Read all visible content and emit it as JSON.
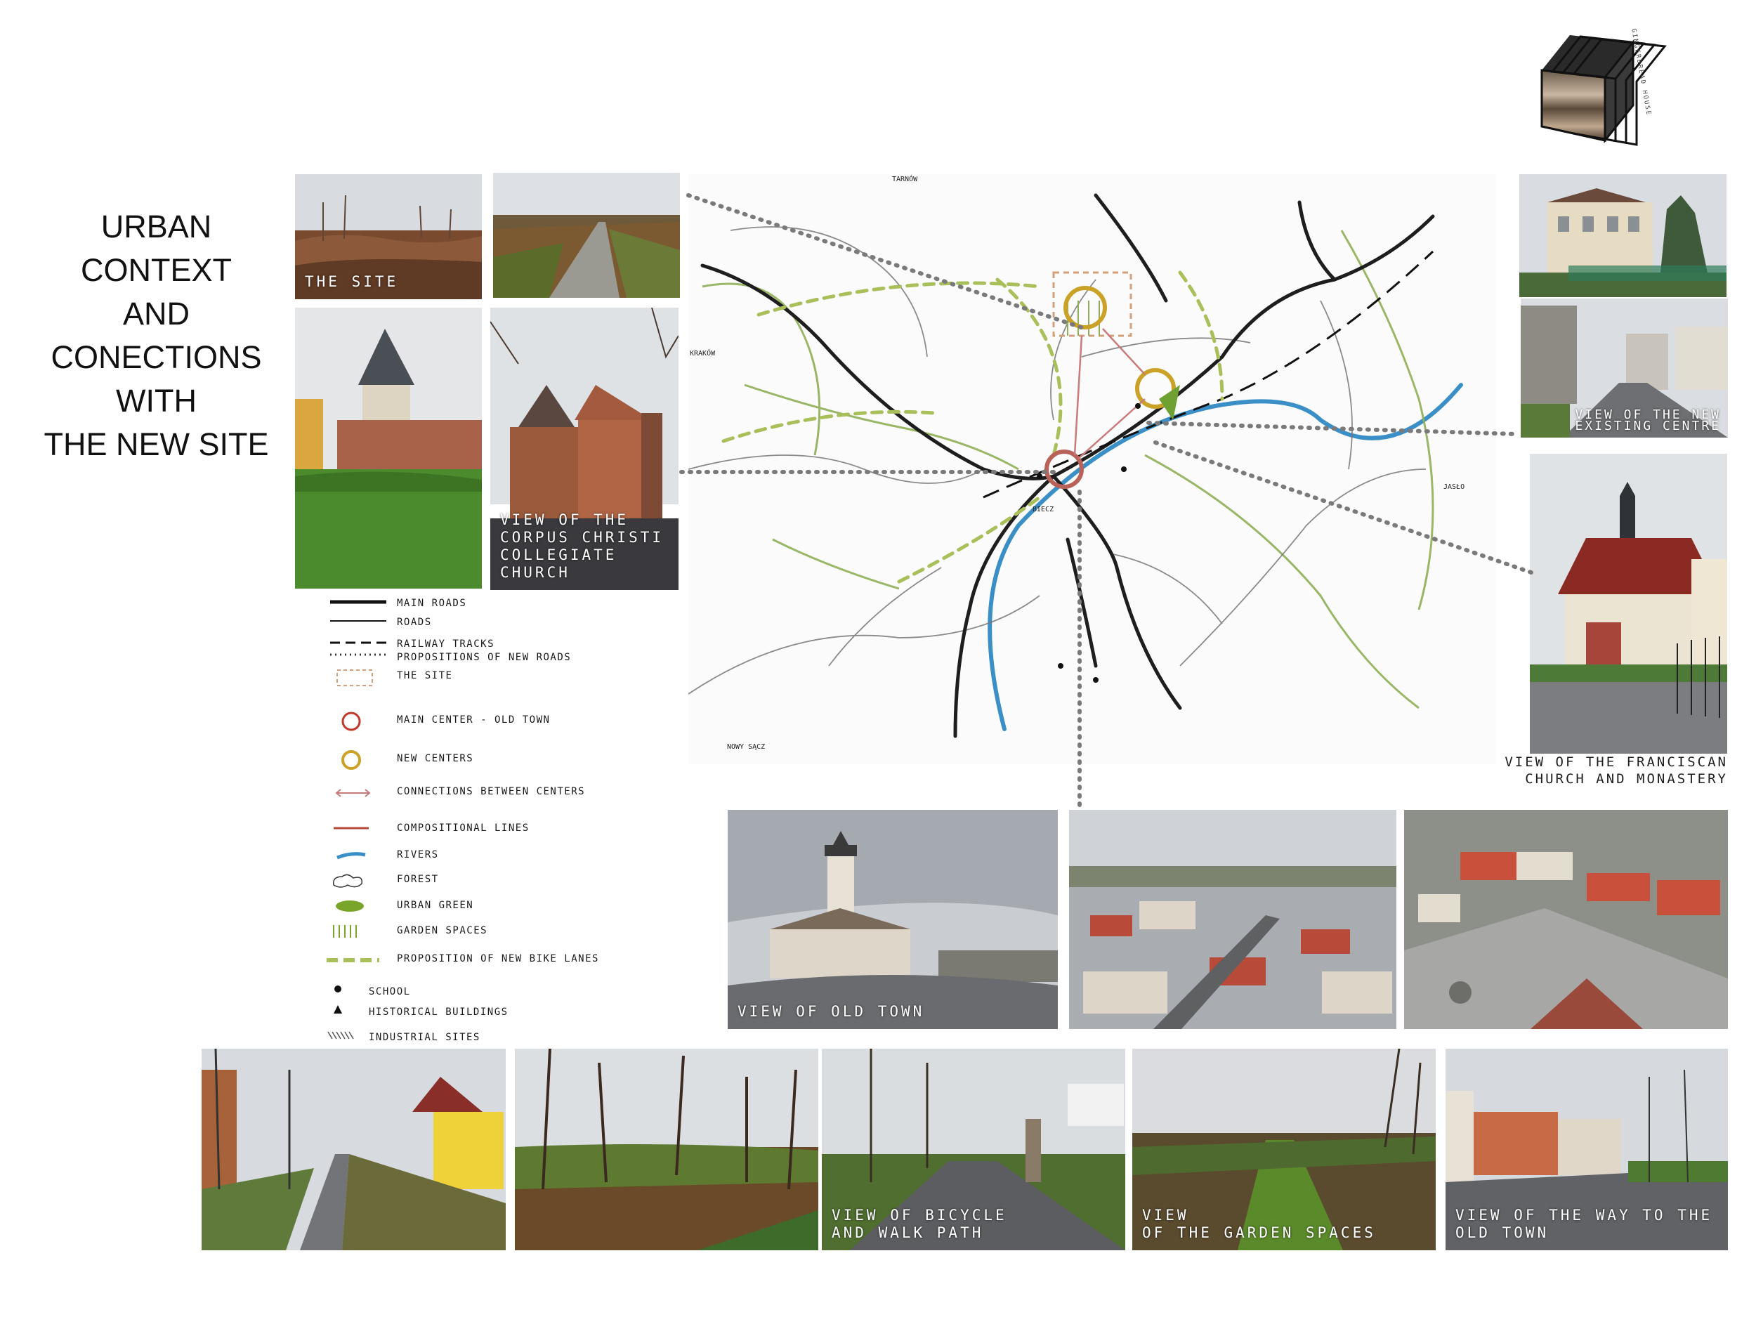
{
  "title": "URBAN CONTEXT\nAND\nCONECTIONS\nWITH\nTHE NEW SITE",
  "brand": {
    "name": "GINGERBREAD HOUSE"
  },
  "photos": {
    "site": {
      "caption": "THE SITE"
    },
    "collegiate": {
      "caption": "VIEW OF THE\nCORPUS CHRISTI\nCOLLEGIATE\nCHURCH"
    },
    "new_centre": {
      "caption": "VIEW OF THE NEW\nEXISTING CENTRE"
    },
    "franciscan": {
      "caption": "VIEW OF THE FRANCISCAN\nCHURCH AND MONASTERY"
    },
    "old_town": {
      "caption": "VIEW OF OLD TOWN"
    },
    "bicycle": {
      "caption": "VIEW OF BICYCLE\nAND WALK PATH"
    },
    "garden": {
      "caption": "VIEW\nOF THE GARDEN SPACES"
    },
    "way": {
      "caption": "VIEW OF THE WAY TO THE\nOLD TOWN"
    }
  },
  "map": {
    "labels": {
      "north": "TARNÓW",
      "west": "KRAKÓW",
      "east": "JASŁO",
      "south": "NOWY SĄCZ",
      "center": "BIECZ"
    }
  },
  "legend": [
    {
      "label": "MAIN ROADS",
      "symbol": "main-road"
    },
    {
      "label": "ROADS",
      "symbol": "road"
    },
    {
      "label": "RAILWAY TRACKS",
      "symbol": "railway"
    },
    {
      "label": "PROPOSITIONS OF NEW ROADS",
      "symbol": "new-road"
    },
    {
      "label": "THE SITE",
      "symbol": "site"
    },
    {
      "label": "MAIN CENTER - OLD TOWN",
      "symbol": "main-center"
    },
    {
      "label": "NEW CENTERS",
      "symbol": "new-center"
    },
    {
      "label": "CONNECTIONS BETWEEN CENTERS",
      "symbol": "connection"
    },
    {
      "label": "COMPOSITIONAL LINES",
      "symbol": "compositional"
    },
    {
      "label": "RIVERS",
      "symbol": "river"
    },
    {
      "label": "FOREST",
      "symbol": "forest"
    },
    {
      "label": "URBAN GREEN",
      "symbol": "urban-green"
    },
    {
      "label": "GARDEN SPACES",
      "symbol": "garden"
    },
    {
      "label": "PROPOSITION OF NEW BIKE LANES",
      "symbol": "bike-lane"
    },
    {
      "label": "SCHOOL",
      "symbol": "school"
    },
    {
      "label": "HISTORICAL BUILDINGS",
      "symbol": "historical"
    },
    {
      "label": "INDUSTRIAL SITES",
      "symbol": "industrial"
    }
  ],
  "colors": {
    "main_center": "#c0392b",
    "new_center": "#c9a227",
    "river": "#3b8fc7",
    "green": "#7aa52b",
    "bike": "#a8bf5a",
    "connection": "#c97a7a"
  }
}
